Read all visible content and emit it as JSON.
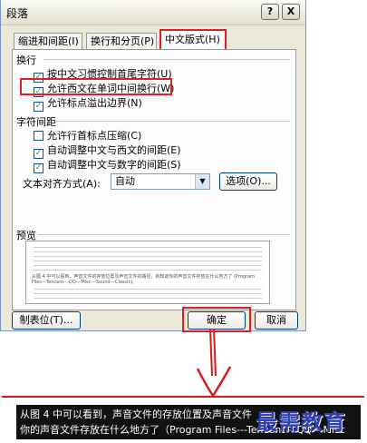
{
  "dialog": {
    "title": "段落",
    "help_label": "?",
    "close_label": "X"
  },
  "tabs": [
    {
      "label": "缩进和间距(I)",
      "active": false
    },
    {
      "label": "换行和分页(P)",
      "active": false
    },
    {
      "label": "中文版式(H)",
      "active": true
    }
  ],
  "sections": {
    "line_break_label": "换行",
    "char_spacing_label": "字符间距",
    "preview_label": "预览"
  },
  "line_break_options": [
    {
      "label": "按中文习惯控制首尾字符(U)",
      "checked": true
    },
    {
      "label": "允许西文在单词中间换行(W)",
      "checked": true,
      "highlighted": true
    },
    {
      "label": "允许标点溢出边界(N)",
      "checked": true
    }
  ],
  "char_spacing_options": [
    {
      "label": "允许行首标点压缩(C)",
      "checked": false
    },
    {
      "label": "自动调整中文与西文的间距(E)",
      "checked": true
    },
    {
      "label": "自动调整中文与数字的间距(S)",
      "checked": true
    }
  ],
  "alignment": {
    "label": "文本对齐方式(A):",
    "value": "自动",
    "options_button": "选项(O)..."
  },
  "preview": {
    "text": "从图 4 中可以看到，声音文件的存放位置及声音文件的路径，就知道你的声音文件存放在什么地方了 (Program Files---Tencent---QQ---Misc---Sound---Classic)。"
  },
  "buttons": {
    "tabs_button": "制表位(T)...",
    "ok_button": "确定",
    "cancel_button": "取消"
  },
  "caption": {
    "line1": "从图 4 中可以看到，声音文件的存放位置及声音文件",
    "line2": "你的声音文件存放在什么地方了（Program Files---Tencent---QQ---Misc"
  },
  "watermark": "最需教育",
  "colors": {
    "highlight_red": "#e02020",
    "dialog_bg": "#ece9d8",
    "check_green": "#21a121",
    "watermark_blue": "#2f3fb4"
  }
}
